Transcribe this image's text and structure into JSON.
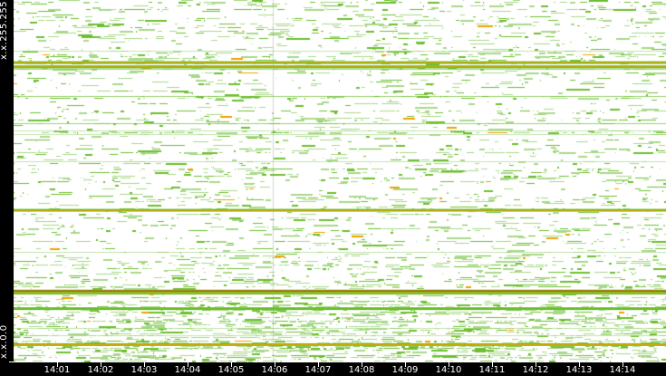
{
  "chart_data": {
    "type": "heatmap",
    "title": "",
    "xlabel": "",
    "ylabel": "",
    "x_ticks": [
      "14:01",
      "14:02",
      "14:03",
      "14:04",
      "14:05",
      "14:06",
      "14:07",
      "14:08",
      "14:09",
      "14:10",
      "14:11",
      "14:12",
      "14:13",
      "14:14"
    ],
    "x_range_minutes": [
      0.0,
      15.0
    ],
    "y_labels": {
      "top": "x.x.255.255",
      "bottom": "x.x.0.0"
    },
    "y_range": [
      0,
      65535
    ],
    "colors": {
      "low": "#a8d88a",
      "medium": "#6cbf2e",
      "high": "#f0a000",
      "peak": "#e83a00",
      "background": "#ffffff"
    },
    "hot_rows": [
      {
        "y": 54300,
        "level": "high"
      },
      {
        "y": 53500,
        "level": "high"
      },
      {
        "y": 27600,
        "level": "high"
      },
      {
        "y": 13000,
        "level": "peak"
      },
      {
        "y": 12600,
        "level": "high"
      },
      {
        "y": 9800,
        "level": "medium"
      },
      {
        "y": 3300,
        "level": "high"
      }
    ],
    "grid": false
  }
}
